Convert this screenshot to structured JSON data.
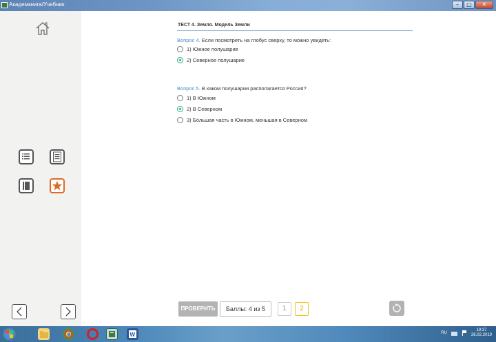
{
  "window": {
    "title": "Академкнига/Учебник",
    "minimize_label": "–",
    "maximize_label": "□",
    "close_label": "✕"
  },
  "test": {
    "title": "ТЕСТ 4. Земля. Модель Земли"
  },
  "questions": [
    {
      "prefix": "Вопрос",
      "number": "4.",
      "text": "Если посмотреть на глобус сверху, то можно увидеть:",
      "options": [
        {
          "label": "1)",
          "text": "Южное полушарие",
          "selected": false
        },
        {
          "label": "2)",
          "text": "Северное полушарие",
          "selected": true
        }
      ]
    },
    {
      "prefix": "Вопрос",
      "number": "5.",
      "text": "В каком полушарии располагается Россия?",
      "options": [
        {
          "label": "1)",
          "text": "В Южном",
          "selected": false
        },
        {
          "label": "2)",
          "text": "В Северном",
          "selected": true
        },
        {
          "label": "3)",
          "text": "Бо́льшая часть в Южном, меньшая в Северном",
          "selected": false
        }
      ]
    }
  ],
  "footer": {
    "check_label": "ПРОВЕРИТЬ",
    "score_label": "Баллы: 4 из 5",
    "pages": [
      "1",
      "2"
    ],
    "active_page": "2"
  },
  "taskbar": {
    "lang": "RU",
    "time": "19:37",
    "date": "26.02.2019"
  },
  "colors": {
    "accent_blue": "#4a8ccc",
    "radio_selected": "#2aa88a",
    "active_page": "#f2c21a",
    "favorite_orange": "#e06a23"
  },
  "icons": {
    "home": "home-icon",
    "toc": "list-icon",
    "page": "document-icon",
    "book": "book-icon",
    "favorite": "star-icon",
    "prev": "chevron-left-icon",
    "next": "chevron-right-icon",
    "reset": "reset-icon"
  }
}
